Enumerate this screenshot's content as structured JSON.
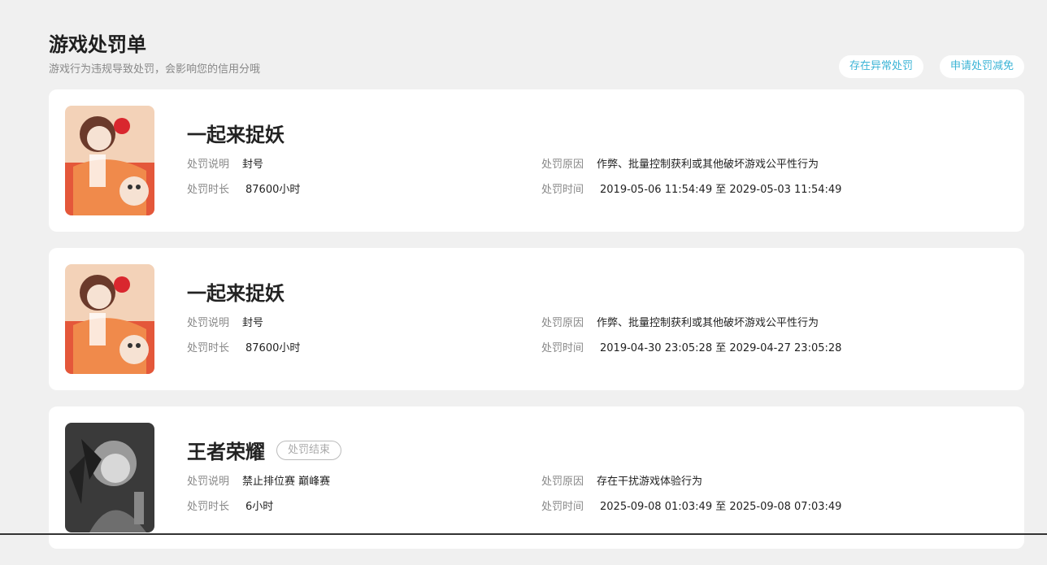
{
  "page": {
    "title": "游戏处罚单",
    "subtitle": "游戏行为违规导致处罚，会影响您的信用分哦"
  },
  "actions": {
    "abnormal_label": "存在异常处罚",
    "reduce_label": "申请处罚减免"
  },
  "labels": {
    "desc": "处罚说明",
    "reason": "处罚原因",
    "duration": "处罚时长",
    "time": "处罚时间"
  },
  "cards": [
    {
      "game": "一起来捉妖",
      "desc": "封号",
      "reason": "作弊、批量控制获利或其他破坏游戏公平性行为",
      "duration": "87600小时",
      "time": "2019-05-06 11:54:49 至 2029-05-03 11:54:49",
      "icon": "game-art-colorful"
    },
    {
      "game": "一起来捉妖",
      "desc": "封号",
      "reason": "作弊、批量控制获利或其他破坏游戏公平性行为",
      "duration": "87600小时",
      "time": "2019-04-30 23:05:28 至 2029-04-27 23:05:28",
      "icon": "game-art-colorful"
    },
    {
      "game": "王者荣耀",
      "status": "处罚结束",
      "desc": "禁止排位赛 巅峰赛",
      "reason": "存在干扰游戏体验行为",
      "duration": "6小时",
      "time": "2025-09-08 01:03:49 至 2025-09-08 07:03:49",
      "icon": "game-art-grayscale"
    }
  ],
  "colors": {
    "accent": "#3bb4d6",
    "background": "#f0f0f0"
  }
}
